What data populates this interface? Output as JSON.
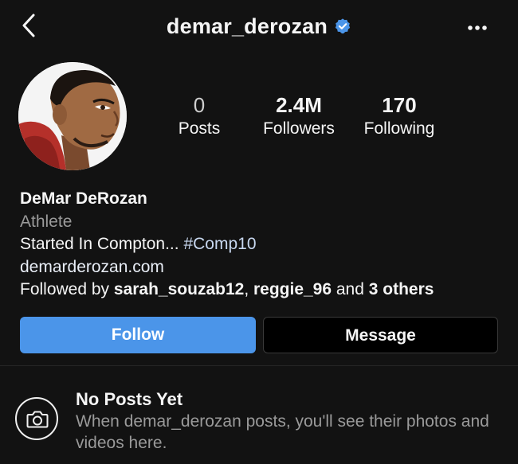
{
  "header": {
    "username": "demar_derozan",
    "back_icon": "chevron-left-icon",
    "verified_icon": "verified-badge-icon",
    "more_icon": "more-horizontal-icon"
  },
  "stats": {
    "posts_count": "0",
    "posts_label": "Posts",
    "followers_count": "2.4M",
    "followers_label": "Followers",
    "following_count": "170",
    "following_label": "Following"
  },
  "bio": {
    "name": "DeMar DeRozan",
    "category": "Athlete",
    "text_prefix": "Started In Compton... ",
    "hashtag": "#Comp10",
    "website": "demarderozan.com",
    "followed_by_prefix": "Followed by ",
    "follower_1": "sarah_souzab12",
    "separator": ", ",
    "follower_2": "reggie_96",
    "and_text": " and ",
    "others": "3 others"
  },
  "actions": {
    "follow_label": "Follow",
    "message_label": "Message"
  },
  "empty_state": {
    "icon": "camera-icon",
    "title": "No Posts Yet",
    "body": "When demar_derozan posts, you'll see their photos and videos here."
  },
  "colors": {
    "background": "#121212",
    "follow_button": "#4b95e9",
    "verified": "#4b95e9",
    "muted_text": "#9a9a9a"
  }
}
